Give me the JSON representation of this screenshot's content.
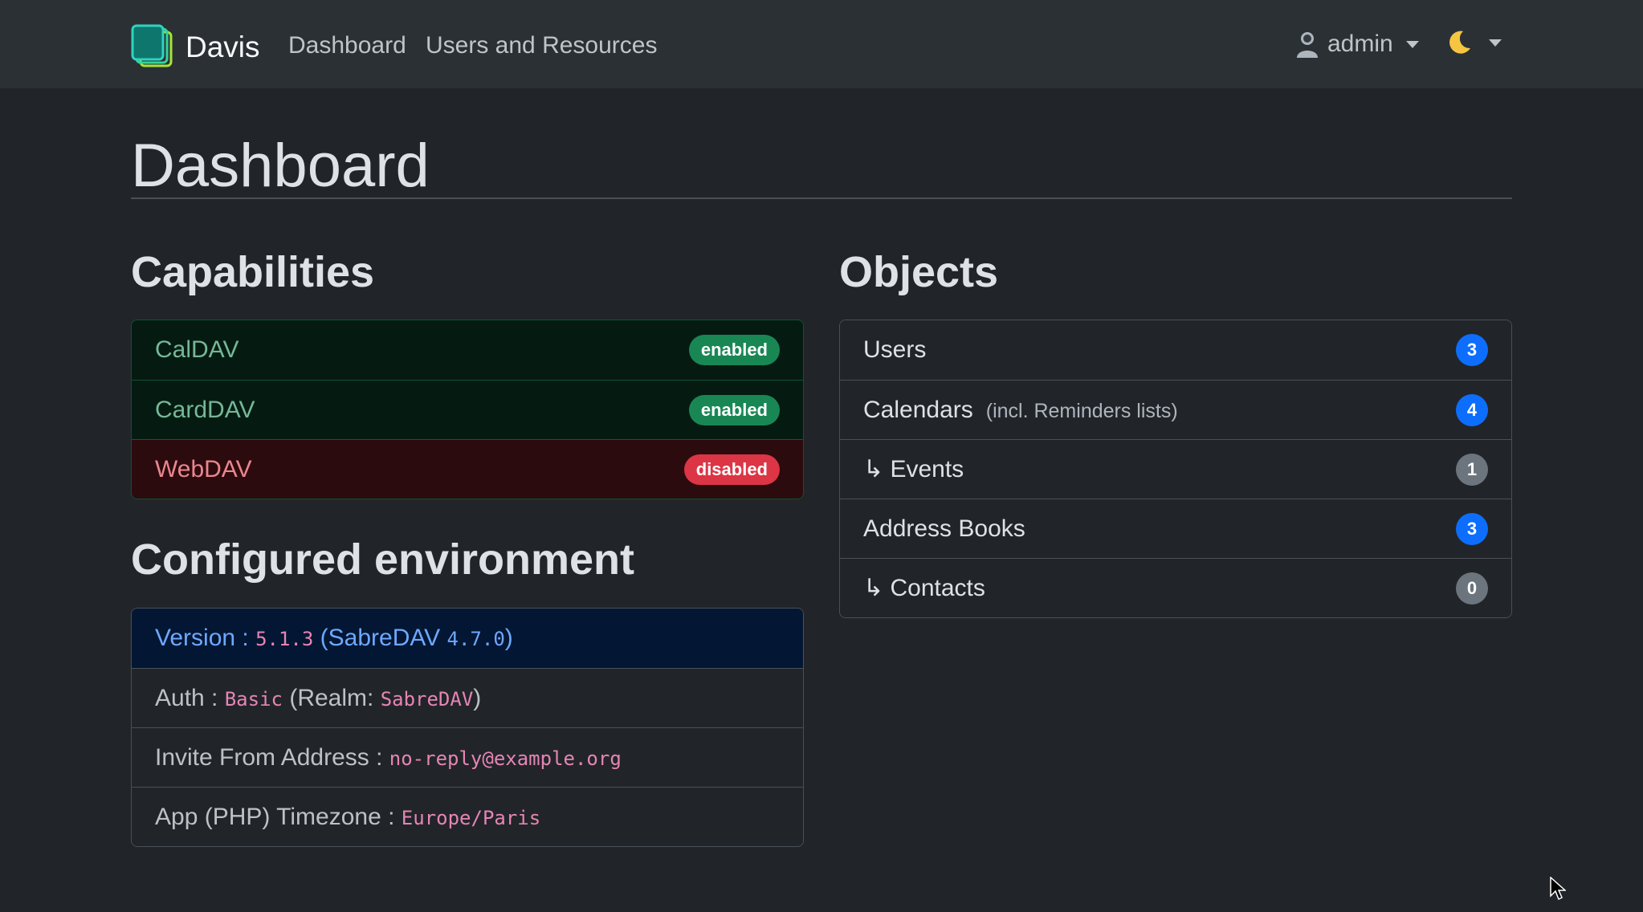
{
  "navbar": {
    "brand": "Davis",
    "links": [
      "Dashboard",
      "Users and Resources"
    ],
    "user": "admin",
    "theme_icon": "moon-icon"
  },
  "page_title": "Dashboard",
  "capabilities": {
    "title": "Capabilities",
    "items": [
      {
        "label": "CalDAV",
        "status": "enabled"
      },
      {
        "label": "CardDAV",
        "status": "enabled"
      },
      {
        "label": "WebDAV",
        "status": "disabled"
      }
    ]
  },
  "environment": {
    "title": "Configured environment",
    "version": {
      "label": "Version :",
      "value": "5.1.3",
      "sabre_label": "(SabreDAV",
      "sabre_value": "4.7.0",
      "close": ")"
    },
    "auth": {
      "label": "Auth :",
      "value": "Basic",
      "realm_label": "(Realm:",
      "realm_value": "SabreDAV",
      "close": ")"
    },
    "invite": {
      "label": "Invite From Address :",
      "value": "no-reply@example.org"
    },
    "timezone": {
      "label": "App (PHP) Timezone :",
      "value": "Europe/Paris"
    }
  },
  "objects": {
    "title": "Objects",
    "items": [
      {
        "label": "Users",
        "sub": "",
        "count": "3"
      },
      {
        "label": "Calendars",
        "sub": "(incl. Reminders lists)",
        "count": "4"
      },
      {
        "label": "↳ Events",
        "sub": "",
        "count": "1"
      },
      {
        "label": "Address Books",
        "sub": "",
        "count": "3"
      },
      {
        "label": "↳ Contacts",
        "sub": "",
        "count": "0"
      }
    ]
  },
  "colors": {
    "accent": "#0d6efd",
    "success": "#198754",
    "danger": "#dc3545",
    "secondary": "#6c757d",
    "code": "#e685b5"
  }
}
